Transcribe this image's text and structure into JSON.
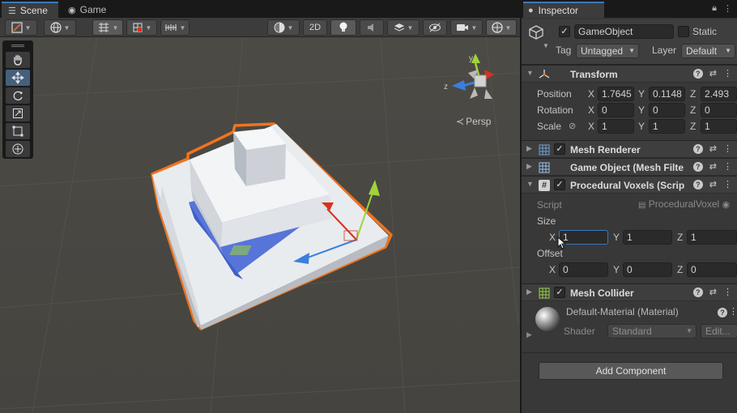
{
  "scene": {
    "tabs": [
      {
        "label": "Scene",
        "icon": "list-icon"
      },
      {
        "label": "Game",
        "icon": "gamepad-icon"
      }
    ],
    "toolbar": {
      "mode_2d_label": "2D"
    },
    "gizmo": {
      "projection_label": "Persp",
      "axes": {
        "y": "y",
        "z": "z"
      }
    },
    "tools": [
      "hand-tool",
      "move-tool",
      "rotate-tool",
      "scale-tool",
      "rect-tool",
      "transform-tool"
    ],
    "selected_tool": "move-tool",
    "colors": {
      "selection_outline": "#f0731e",
      "x_axis": "#d8321e",
      "y_axis": "#9fd43a",
      "z_axis": "#3a7fe0"
    }
  },
  "inspector": {
    "tab_label": "Inspector",
    "game_object": {
      "active": true,
      "name": "GameObject",
      "static_label": "Static",
      "tag_label": "Tag",
      "tag_value": "Untagged",
      "layer_label": "Layer",
      "layer_value": "Default"
    },
    "transform": {
      "title": "Transform",
      "position": {
        "label": "Position",
        "x": "1.7645",
        "y": "0.1148",
        "z": "2.493"
      },
      "rotation": {
        "label": "Rotation",
        "x": "0",
        "y": "0",
        "z": "0"
      },
      "scale": {
        "label": "Scale",
        "x": "1",
        "y": "1",
        "z": "1"
      }
    },
    "components": {
      "mesh_renderer": "Mesh Renderer",
      "mesh_filter": "Game Object (Mesh Filte",
      "procedural_voxels": "Procedural Voxels (Scrip",
      "mesh_collider": "Mesh Collider"
    },
    "procedural": {
      "script_label": "Script",
      "script_value": "ProceduralVoxel",
      "size_label": "Size",
      "size": {
        "x": "1",
        "y": "1",
        "z": "1"
      },
      "offset_label": "Offset",
      "offset": {
        "x": "0",
        "y": "0",
        "z": "0"
      }
    },
    "material": {
      "name": "Default-Material (Material)",
      "shader_label": "Shader",
      "shader_value": "Standard",
      "edit_label": "Edit..."
    },
    "axis_letters": {
      "x": "X",
      "y": "Y",
      "z": "Z"
    },
    "add_component_label": "Add Component"
  }
}
